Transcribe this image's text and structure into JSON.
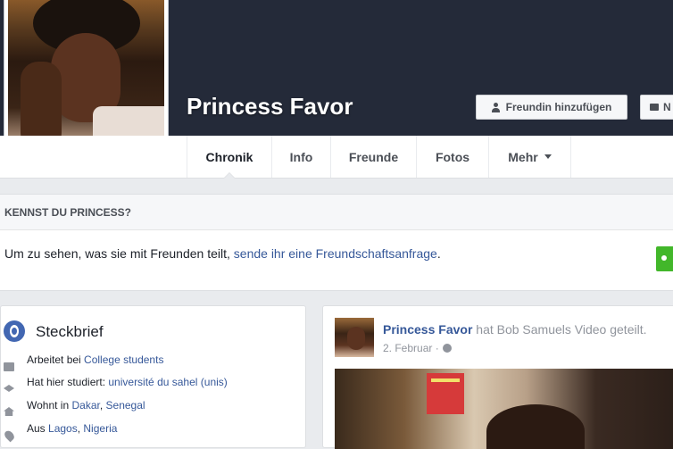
{
  "profile": {
    "name": "Princess Favor",
    "add_friend_label": "Freundin hinzufügen",
    "message_label": "N"
  },
  "nav": {
    "tabs": [
      {
        "label": "Chronik",
        "active": true
      },
      {
        "label": "Info"
      },
      {
        "label": "Freunde"
      },
      {
        "label": "Fotos"
      },
      {
        "label": "Mehr"
      }
    ]
  },
  "know": {
    "heading": "KENNST DU PRINCESS?",
    "text": "Um zu sehen, was sie mit Freunden teilt, ",
    "link": "sende ihr eine Freundschaftsanfrage",
    "suffix": "."
  },
  "steckbrief": {
    "title": "Steckbrief",
    "items": [
      {
        "icon": "briefcase-icon",
        "prefix": "Arbeitet bei ",
        "link1": "College students",
        "sep": "",
        "link2": ""
      },
      {
        "icon": "graduation-cap-icon",
        "prefix": "Hat hier studiert: ",
        "link1": "université du sahel (unis)",
        "sep": "",
        "link2": ""
      },
      {
        "icon": "home-icon",
        "prefix": "Wohnt in ",
        "link1": "Dakar",
        "sep": ", ",
        "link2": "Senegal"
      },
      {
        "icon": "location-pin-icon",
        "prefix": "Aus ",
        "link1": "Lagos",
        "sep": ", ",
        "link2": "Nigeria"
      }
    ]
  },
  "post": {
    "author": "Princess Favor",
    "action": " hat Bob Samuels Video geteilt.",
    "date": "2. Februar ·"
  },
  "colors": {
    "cover": "#242a39",
    "link": "#365899",
    "accent_green": "#42b72a"
  }
}
